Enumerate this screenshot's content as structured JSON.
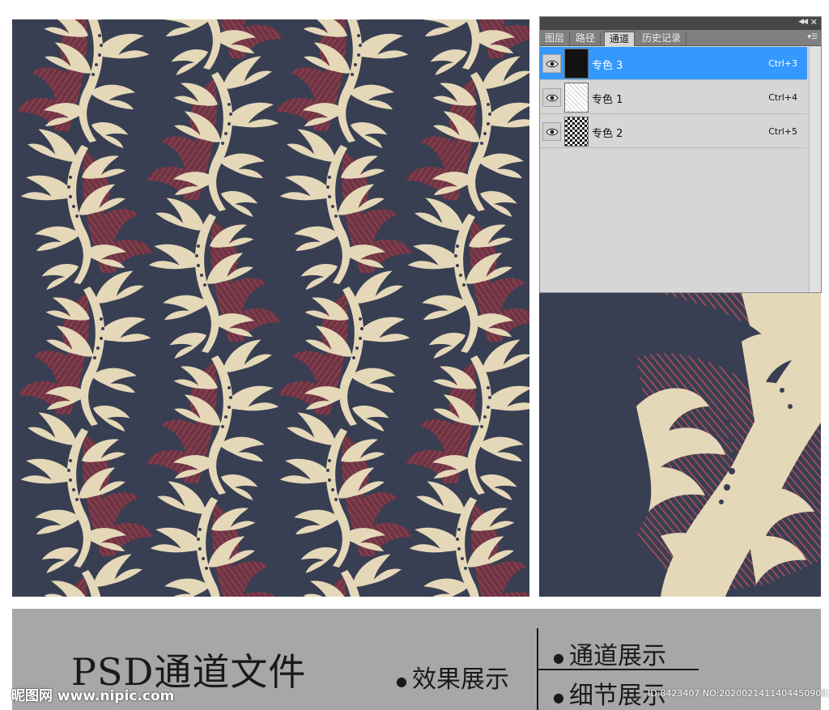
{
  "colors": {
    "background_navy": "#393f52",
    "leaf_cream": "#e4d8b9",
    "shadow_red": "#7d3a49",
    "hatch_red": "#c8505a",
    "selection_blue": "#3399ff"
  },
  "panel": {
    "tabs": [
      {
        "label": "图层"
      },
      {
        "label": "路径"
      },
      {
        "label": "通道"
      },
      {
        "label": "历史记录"
      }
    ],
    "active_tab": "通道",
    "icons": {
      "collapse": "double-chevron-left-icon",
      "close": "close-icon",
      "menu": "panel-menu-icon"
    },
    "channels": [
      {
        "name": "专色 3",
        "shortcut": "Ctrl+3",
        "selected": true
      },
      {
        "name": "专色 1",
        "shortcut": "Ctrl+4",
        "selected": false
      },
      {
        "name": "专色 2",
        "shortcut": "Ctrl+5",
        "selected": false
      }
    ]
  },
  "caption": {
    "title": "PSD通道文件",
    "items": [
      {
        "label": "效果展示"
      },
      {
        "label": "通道展示"
      },
      {
        "label": "细节展示"
      }
    ]
  },
  "watermark": {
    "logo": "昵图网 www.nipic.com",
    "id_text": "ID:8423407 NO:20200214114044509082"
  }
}
